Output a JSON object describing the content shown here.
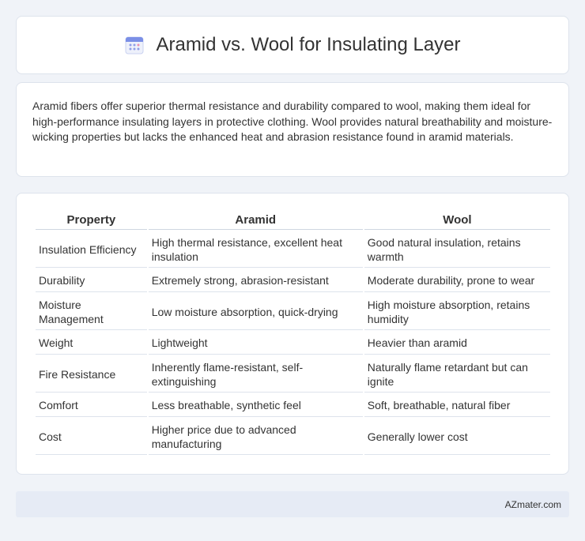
{
  "header": {
    "title": "Aramid vs. Wool for Insulating Layer",
    "icon": "calendar-icon"
  },
  "summary": {
    "text": "Aramid fibers offer superior thermal resistance and durability compared to wool, making them ideal for high-performance insulating layers in protective clothing. Wool provides natural breathability and moisture-wicking properties but lacks the enhanced heat and abrasion resistance found in aramid materials."
  },
  "table": {
    "headers": [
      "Property",
      "Aramid",
      "Wool"
    ],
    "rows": [
      [
        "Insulation Efficiency",
        "High thermal resistance, excellent heat insulation",
        "Good natural insulation, retains warmth"
      ],
      [
        "Durability",
        "Extremely strong, abrasion-resistant",
        "Moderate durability, prone to wear"
      ],
      [
        "Moisture Management",
        "Low moisture absorption, quick-drying",
        "High moisture absorption, retains humidity"
      ],
      [
        "Weight",
        "Lightweight",
        "Heavier than aramid"
      ],
      [
        "Fire Resistance",
        "Inherently flame-resistant, self-extinguishing",
        "Naturally flame retardant but can ignite"
      ],
      [
        "Comfort",
        "Less breathable, synthetic feel",
        "Soft, breathable, natural fiber"
      ],
      [
        "Cost",
        "Higher price due to advanced manufacturing",
        "Generally lower cost"
      ]
    ]
  },
  "footer": {
    "text": "AZmater.com"
  }
}
